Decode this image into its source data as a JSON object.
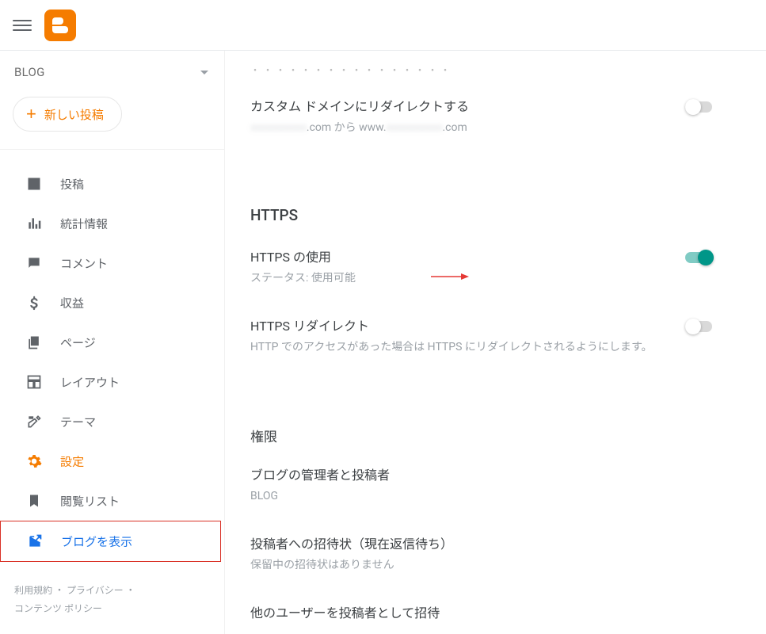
{
  "sidebar": {
    "blogLabel": "BLOG",
    "newPost": "新しい投稿",
    "items": [
      {
        "label": "投稿"
      },
      {
        "label": "統計情報"
      },
      {
        "label": "コメント"
      },
      {
        "label": "収益"
      },
      {
        "label": "ページ"
      },
      {
        "label": "レイアウト"
      },
      {
        "label": "テーマ"
      },
      {
        "label": "設定"
      },
      {
        "label": "閲覧リスト"
      },
      {
        "label": "ブログを表示"
      }
    ],
    "footer": {
      "terms": "利用規約",
      "privacy": "プライバシー",
      "policy": "コンテンツ ポリシー"
    }
  },
  "main": {
    "partialTop": "・・・・・・・・・・・・・・・・",
    "redirect": {
      "title": "カスタム ドメインにリダイレクトする",
      "subPrefix": "",
      "subMaskA": "xxxxxxxxxxx",
      "subMid": ".com から www.",
      "subMaskB": "xxxxxxxxxxx",
      "subEnd": ".com"
    },
    "https": {
      "header": "HTTPS",
      "use": {
        "title": "HTTPS の使用",
        "sub": "ステータス: 使用可能"
      },
      "redirect": {
        "title": "HTTPS リダイレクト",
        "sub": "HTTP でのアクセスがあった場合は HTTPS にリダイレクトされるようにします。"
      }
    },
    "perm": {
      "header": "権限",
      "admins": {
        "title": "ブログの管理者と投稿者",
        "sub": "BLOG"
      },
      "invites": {
        "title": "投稿者への招待状（現在返信待ち）",
        "sub": "保留中の招待状はありません"
      },
      "inviteMore": {
        "title": "他のユーザーを投稿者として招待"
      }
    }
  }
}
